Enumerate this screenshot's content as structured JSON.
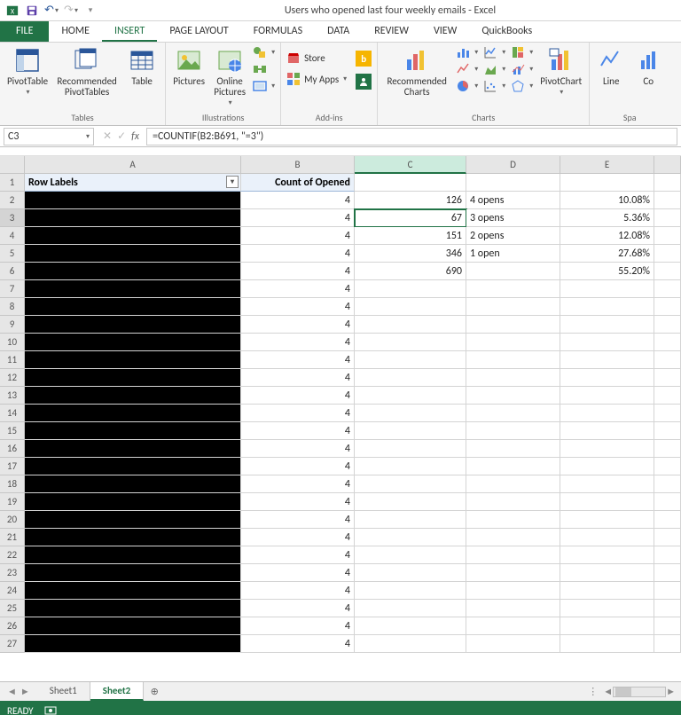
{
  "title": "Users who opened last four weekly emails - Excel",
  "tabs": [
    "FILE",
    "HOME",
    "INSERT",
    "PAGE LAYOUT",
    "FORMULAS",
    "DATA",
    "REVIEW",
    "VIEW",
    "QuickBooks"
  ],
  "active_tab": "INSERT",
  "ribbon": {
    "tables": {
      "label": "Tables",
      "pivot": "PivotTable",
      "recommended": "Recommended\nPivotTables",
      "table": "Table"
    },
    "illustrations": {
      "label": "Illustrations",
      "pictures": "Pictures",
      "online": "Online\nPictures"
    },
    "addins": {
      "label": "Add-ins",
      "store": "Store",
      "myapps": "My Apps"
    },
    "charts": {
      "label": "Charts",
      "recommended": "Recommended\nCharts",
      "pivotchart": "PivotChart"
    },
    "spark": {
      "label": "Spa",
      "line": "Line",
      "col": "Co"
    }
  },
  "namebox": "C3",
  "formula": "=COUNTIF(B2:B691, \"=3\")",
  "columns": [
    "A",
    "B",
    "C",
    "D",
    "E"
  ],
  "active_col": "C",
  "active_row": 3,
  "header_row": {
    "a": "Row Labels",
    "b": "Count of Opened"
  },
  "rows": [
    {
      "n": 1,
      "b": "",
      "c": "",
      "d": "",
      "e": ""
    },
    {
      "n": 2,
      "b": "4",
      "c": "126",
      "d": "4 opens",
      "e": "10.08%"
    },
    {
      "n": 3,
      "b": "4",
      "c": "67",
      "d": "3 opens",
      "e": "5.36%"
    },
    {
      "n": 4,
      "b": "4",
      "c": "151",
      "d": "2 opens",
      "e": "12.08%"
    },
    {
      "n": 5,
      "b": "4",
      "c": "346",
      "d": "1 open",
      "e": "27.68%"
    },
    {
      "n": 6,
      "b": "4",
      "c": "690",
      "d": "",
      "e": "55.20%"
    },
    {
      "n": 7,
      "b": "4",
      "c": "",
      "d": "",
      "e": ""
    },
    {
      "n": 8,
      "b": "4",
      "c": "",
      "d": "",
      "e": ""
    },
    {
      "n": 9,
      "b": "4",
      "c": "",
      "d": "",
      "e": ""
    },
    {
      "n": 10,
      "b": "4",
      "c": "",
      "d": "",
      "e": ""
    },
    {
      "n": 11,
      "b": "4",
      "c": "",
      "d": "",
      "e": ""
    },
    {
      "n": 12,
      "b": "4",
      "c": "",
      "d": "",
      "e": ""
    },
    {
      "n": 13,
      "b": "4",
      "c": "",
      "d": "",
      "e": ""
    },
    {
      "n": 14,
      "b": "4",
      "c": "",
      "d": "",
      "e": ""
    },
    {
      "n": 15,
      "b": "4",
      "c": "",
      "d": "",
      "e": ""
    },
    {
      "n": 16,
      "b": "4",
      "c": "",
      "d": "",
      "e": ""
    },
    {
      "n": 17,
      "b": "4",
      "c": "",
      "d": "",
      "e": ""
    },
    {
      "n": 18,
      "b": "4",
      "c": "",
      "d": "",
      "e": ""
    },
    {
      "n": 19,
      "b": "4",
      "c": "",
      "d": "",
      "e": ""
    },
    {
      "n": 20,
      "b": "4",
      "c": "",
      "d": "",
      "e": ""
    },
    {
      "n": 21,
      "b": "4",
      "c": "",
      "d": "",
      "e": ""
    },
    {
      "n": 22,
      "b": "4",
      "c": "",
      "d": "",
      "e": ""
    },
    {
      "n": 23,
      "b": "4",
      "c": "",
      "d": "",
      "e": ""
    },
    {
      "n": 24,
      "b": "4",
      "c": "",
      "d": "",
      "e": ""
    },
    {
      "n": 25,
      "b": "4",
      "c": "",
      "d": "",
      "e": ""
    },
    {
      "n": 26,
      "b": "4",
      "c": "",
      "d": "",
      "e": ""
    },
    {
      "n": 27,
      "b": "4",
      "c": "",
      "d": "",
      "e": ""
    }
  ],
  "sheets": [
    "Sheet1",
    "Sheet2"
  ],
  "active_sheet": "Sheet2",
  "status": "READY"
}
